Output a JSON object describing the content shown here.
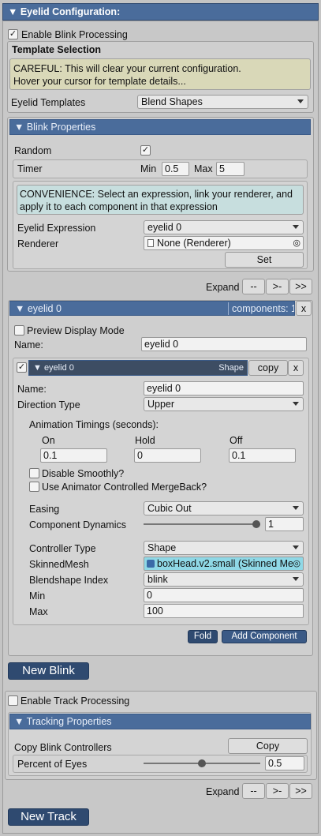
{
  "header": {
    "title": "▼ Eyelid Configuration:"
  },
  "blink": {
    "enable_label": "Enable Blink Processing",
    "enable_checked": true,
    "template": {
      "title": "Template Selection",
      "warning_line1": "CAREFUL: This will clear your current configuration.",
      "warning_line2": "Hover your cursor for template details...",
      "label": "Eyelid Templates",
      "value": "Blend Shapes"
    },
    "properties": {
      "title": "▼ Blink Properties",
      "random_label": "Random",
      "random_checked": true,
      "timer_label": "Timer",
      "min_label": "Min",
      "min_value": "0.5",
      "max_label": "Max",
      "max_value": "5",
      "convenience_line1": "CONVENIENCE: Select an expression, link your renderer, and",
      "convenience_line2": "apply it to each component in that expression",
      "expression_label": "Eyelid Expression",
      "expression_value": "eyelid 0",
      "renderer_label": "Renderer",
      "renderer_value": "None (Renderer)",
      "set_label": "Set"
    },
    "expand": {
      "label": "Expand",
      "b1": "--",
      "b2": ">-",
      "b3": ">>"
    },
    "expression": {
      "title": "▼ eyelid 0",
      "components_label": "components: 1",
      "close": "x",
      "preview_label": "Preview Display Mode",
      "name_label": "Name:",
      "name_value": "eyelid 0",
      "component": {
        "checked": true,
        "title": "▼ eyelid 0",
        "type_tag": "Shape",
        "copy_label": "copy",
        "close": "x",
        "name_label": "Name:",
        "name_value": "eyelid 0",
        "direction_label": "Direction Type",
        "direction_value": "Upper",
        "timings_label": "Animation Timings (seconds):",
        "on_label": "On",
        "on_value": "0.1",
        "hold_label": "Hold",
        "hold_value": "0",
        "off_label": "Off",
        "off_value": "0.1",
        "disable_smooth_label": "Disable Smoothly?",
        "mergeback_label": "Use Animator Controlled MergeBack?",
        "easing_label": "Easing",
        "easing_value": "Cubic Out",
        "dynamics_label": "Component Dynamics",
        "dynamics_value": "1",
        "dynamics_fraction": 1.0,
        "controller_label": "Controller Type",
        "controller_value": "Shape",
        "mesh_label": "SkinnedMesh",
        "mesh_value": "boxHead.v2.small (Skinned Me",
        "blendshape_label": "Blendshape Index",
        "blendshape_value": "blink",
        "min_label": "Min",
        "min_value": "0",
        "max_label": "Max",
        "max_value": "100"
      },
      "fold_label": "Fold",
      "add_component_label": "Add Component"
    },
    "new_button": "New Blink"
  },
  "track": {
    "enable_label": "Enable Track Processing",
    "enable_checked": false,
    "properties_title": "▼ Tracking Properties",
    "copy_label": "Copy Blink Controllers",
    "copy_button": "Copy",
    "percent_label": "Percent of Eyes",
    "percent_value": "0.5",
    "percent_fraction": 0.5,
    "expand": {
      "label": "Expand",
      "b1": "--",
      "b2": ">-",
      "b3": ">>"
    },
    "new_button": "New Track"
  },
  "colors": {
    "header_blue": "#4a6c9b",
    "dark_button": "#2f4a70",
    "warning_bg": "#d9d8b8",
    "info_bg": "#c7dede",
    "mesh_highlight": "#8fd8e6"
  },
  "icons": {
    "checkbox_check": "✓",
    "object_picker": "◎",
    "renderer_file": "file-icon",
    "mesh": "mesh-icon"
  }
}
